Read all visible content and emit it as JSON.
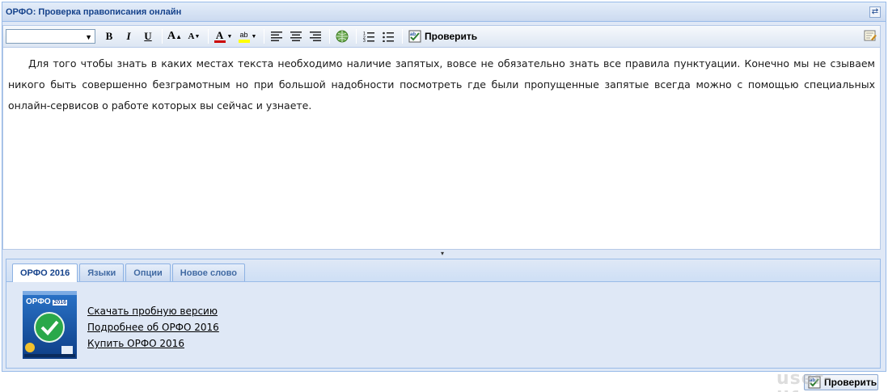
{
  "panel": {
    "title": "ОРФО: Проверка правописания онлайн",
    "header_tool_icon": "refresh-icon"
  },
  "toolbar": {
    "font_select_value": "",
    "bold_label": "B",
    "italic_label": "I",
    "underline_label": "U",
    "grow_font_label": "A",
    "shrink_font_label": "A",
    "font_color_label": "A",
    "highlight_label": "ab",
    "check_label": "Проверить",
    "colors": {
      "font_color": "#cc0000",
      "highlight": "#ffff00"
    }
  },
  "editor": {
    "text": "Для того чтобы знать в каких местах текста необходимо наличие запятых, вовсе не обязательно знать все правила пунктуации. Конечно мы не сзываем никого быть совершенно безграмотным но при большой надобности посмотреть где были пропущенные запятые всегда можно с помощью специальных онлайн-сервисов о работе которых вы сейчас и узнаете."
  },
  "tabs": [
    {
      "label": "ОРФО 2016",
      "active": true
    },
    {
      "label": "Языки",
      "active": false
    },
    {
      "label": "Опции",
      "active": false
    },
    {
      "label": "Новое слово",
      "active": false
    }
  ],
  "product": {
    "box_title": "ОРФО",
    "box_year": "2016",
    "links": [
      "Скачать пробную версию",
      "Подробнее об ОРФО 2016",
      "Купить ОРФО 2016"
    ]
  },
  "footer": {
    "check_button_label": "Проверить"
  },
  "watermark": "user-life.com"
}
